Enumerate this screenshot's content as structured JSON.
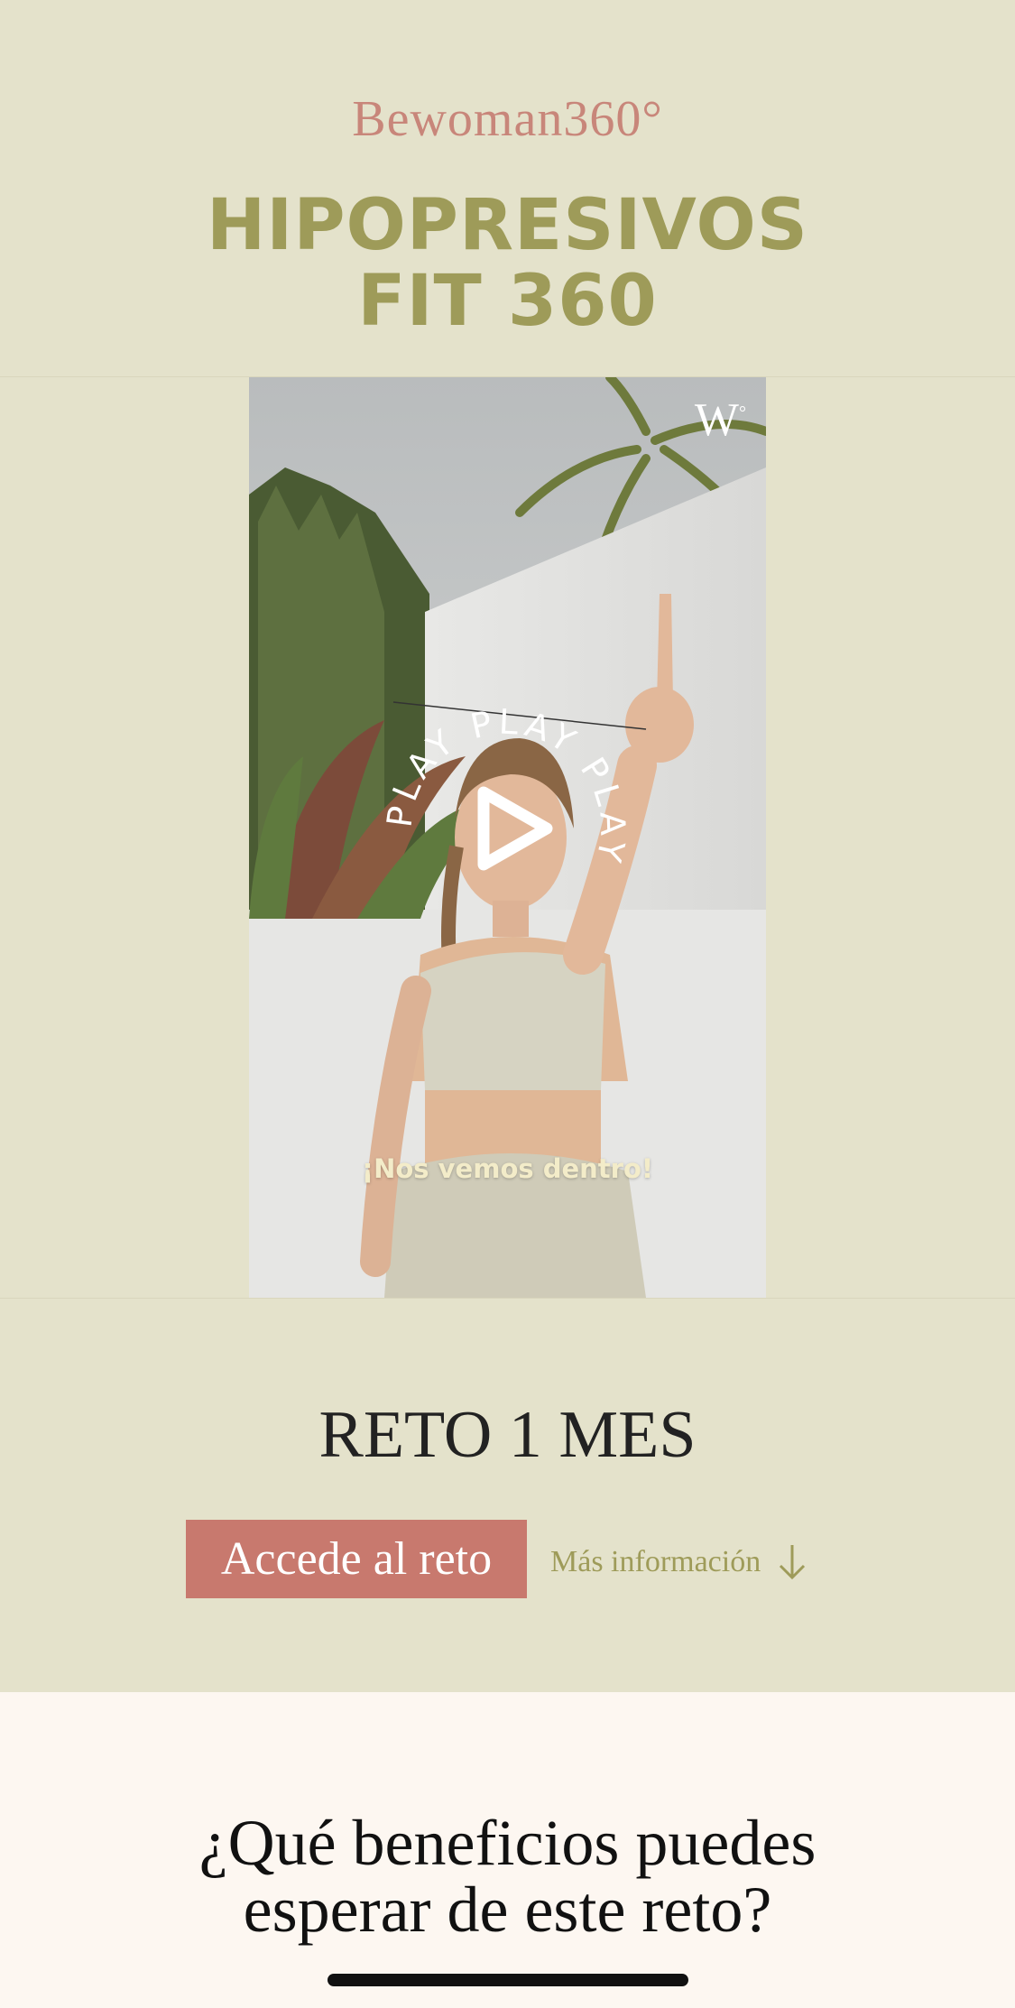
{
  "brand": {
    "logo_text": "Bewoman360°"
  },
  "hero": {
    "title_line1": "HIPOPRESIVOS",
    "title_line2": "FIT 360",
    "colors": {
      "background": "#e4e2cb",
      "title": "#9e9b59",
      "brand": "#c8867a"
    }
  },
  "video": {
    "watermark": "W",
    "play_ring_text": "PLAY PLAY PLAY ",
    "caption": "¡Nos vemos dentro!",
    "icon": "play-icon"
  },
  "reto": {
    "title": "RETO 1 MES",
    "cta_label": "Accede al reto",
    "more_label": "Más información",
    "more_icon": "arrow-down-icon",
    "colors": {
      "cta_bg": "#c8796e"
    }
  },
  "benefits": {
    "heading_line1": "¿Qué beneficios puedes",
    "heading_line2": "esperar de este reto?",
    "colors": {
      "background": "#fdf7f1"
    }
  }
}
